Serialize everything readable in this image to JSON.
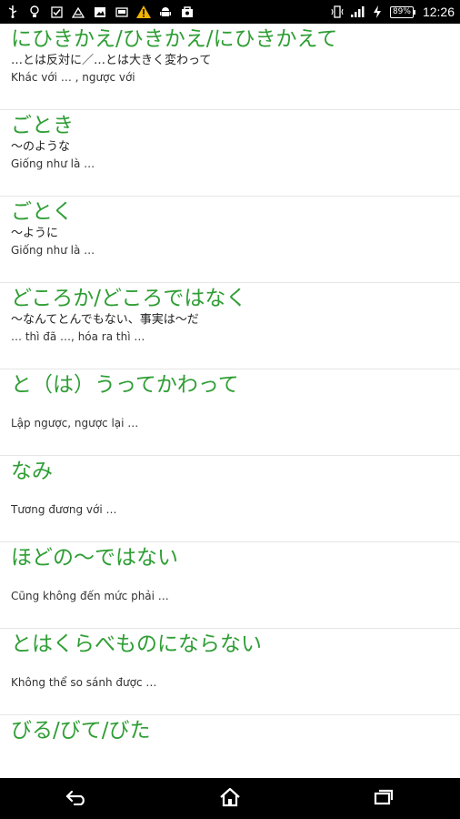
{
  "status_bar": {
    "battery": "89%",
    "time": "12:26",
    "left_icons": [
      "usb-icon",
      "bulb-icon",
      "checkbox-icon",
      "signal-share-icon",
      "image-icon",
      "photo-icon",
      "warning-icon",
      "android-icon",
      "bag-icon"
    ],
    "right_icons": [
      "vibrate-icon",
      "signal-icon",
      "charging-icon"
    ]
  },
  "items": [
    {
      "title": "にひきかえ/ひきかえ/にひきかえて",
      "jp": "…とは反対に／…とは大きく変わって",
      "vi": "Khác với … , ngược với"
    },
    {
      "title": "ごとき",
      "jp": "～のような",
      "vi": "Giống như là …"
    },
    {
      "title": "ごとく",
      "jp": "～ように",
      "vi": "Giống như là …"
    },
    {
      "title": "どころか/どころではなく",
      "jp": "～なんてとんでもない、事実は～だ",
      "vi": "… thì đã …, hóa ra thì …"
    },
    {
      "title": "と（は）うってかわって",
      "jp": "",
      "vi": "Lập ngược, ngược lại …"
    },
    {
      "title": "なみ",
      "jp": "",
      "vi": "Tương đương với …"
    },
    {
      "title": "ほどの～ではない",
      "jp": "",
      "vi": "Cũng không đến mức phải …"
    },
    {
      "title": "とはくらべものにならない",
      "jp": "",
      "vi": "Không thể so sánh được …"
    },
    {
      "title": "びる/びて/びた",
      "jp": "",
      "vi": ""
    }
  ],
  "nav": {
    "back": "back-icon",
    "home": "home-icon",
    "recents": "recents-icon"
  },
  "colors": {
    "accent": "#2f9e35",
    "status_bar": "#000000",
    "divider": "#e6e6e6"
  }
}
